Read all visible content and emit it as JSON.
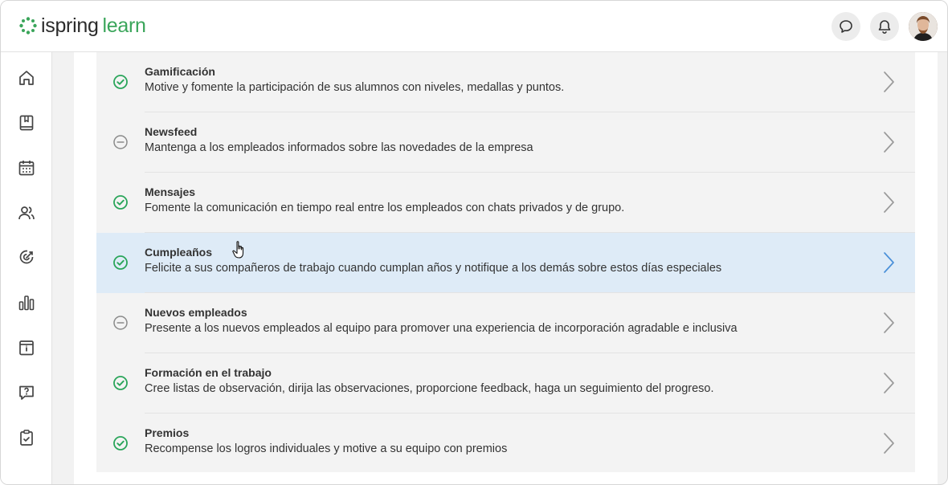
{
  "brand": {
    "name_part1": "ispring",
    "name_part2": "learn",
    "accent": "#3aa55a"
  },
  "header": {
    "chat_icon": "chat-bubble-icon",
    "bell_icon": "bell-icon",
    "avatar": "user-avatar"
  },
  "sidebar": {
    "items": [
      {
        "icon": "home-icon"
      },
      {
        "icon": "book-icon"
      },
      {
        "icon": "calendar-icon"
      },
      {
        "icon": "users-icon"
      },
      {
        "icon": "target-icon"
      },
      {
        "icon": "bar-chart-icon"
      },
      {
        "icon": "info-board-icon"
      },
      {
        "icon": "help-message-icon"
      },
      {
        "icon": "clipboard-check-icon"
      }
    ]
  },
  "features": [
    {
      "title": "Gamificación",
      "description": "Motive y fomente la participación de sus alumnos con niveles, medallas y puntos.",
      "enabled": true
    },
    {
      "title": "Newsfeed",
      "description": "Mantenga a los empleados informados sobre las novedades de la empresa",
      "enabled": false
    },
    {
      "title": "Mensajes",
      "description": "Fomente la comunicación en tiempo real entre los empleados con chats privados y de grupo.",
      "enabled": true
    },
    {
      "title": "Cumpleaños",
      "description": "Felicite a sus compañeros de trabajo cuando cumplan años y notifique a los demás sobre estos días especiales",
      "enabled": true,
      "hovered": true
    },
    {
      "title": "Nuevos empleados",
      "description": "Presente a los nuevos empleados al equipo para promover una experiencia de incorporación agradable e inclusiva",
      "enabled": false
    },
    {
      "title": "Formación en el trabajo",
      "description": "Cree listas de observación, dirija las observaciones, proporcione feedback, haga un seguimiento del progreso.",
      "enabled": true
    },
    {
      "title": "Premios",
      "description": "Recompense los logros individuales y motive a su equipo con premios",
      "enabled": true
    }
  ],
  "colors": {
    "enabled": "#2aa55a",
    "disabled": "#8a8a8a",
    "hover_row": "#deebf7",
    "hover_chevron": "#4a90d9",
    "chevron": "#9a9a9a"
  }
}
